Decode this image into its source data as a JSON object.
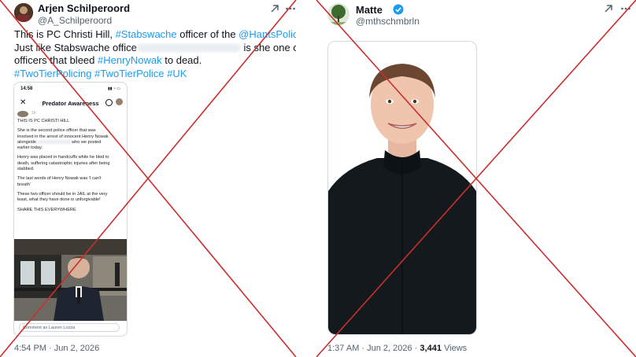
{
  "left_tweet": {
    "author_name": "Arjen Schilperoord",
    "author_handle": "@A_Schilperoord",
    "text": {
      "l1_a": "This is PC Christi Hill, ",
      "l1_tag": "#Stabswache",
      "l1_b": " officer of the ",
      "l1_mention": "@HantsPolice",
      "l1_c": ".",
      "l2_a": "Just like Stabswache office",
      "l2_b": " is she one of the",
      "l3_a": "officers that bleed ",
      "l3_tag": "#HenryNowak",
      "l3_b": " to dead.",
      "l4_tag1": "#TwoTierPolicing",
      "l4_tag2": "#TwoTierPolice",
      "l4_tag3": "#UK"
    },
    "embedded_screenshot": {
      "time": "14:58",
      "title": "Predator Awareness",
      "small_handle": "1h",
      "headline": "THIS IS PC CHRISTI HILL",
      "p1a": "She is the second police officer that was",
      "p1b": "involved in the arrest of innocent Henry Nowak",
      "p1c": "alongside",
      "p1d": "who we posted",
      "p1e": "earlier today.",
      "p2a": "Henry was placed in handcuffs while he bled to",
      "p2b": "death, suffering catastrophic injuries after being",
      "p2c": "stabbed.",
      "p3a": "The last words of Henry Nowak was 'I can't",
      "p3b": "breath'",
      "p4a": "These two officer should be in JAIL at the very",
      "p4b": "least, what they have done is unforgivable!",
      "p5": "SHARE THIS EVERYWHERE",
      "comment_placeholder": "Comment as Lauren Lozza"
    },
    "timestamp": "4:54 PM · Jun 2, 2026"
  },
  "right_tweet": {
    "author_name": "Matte",
    "author_handle": "@mthschmbrln",
    "verified": true,
    "timestamp_time": "1:37 AM · Jun 2, 2026 · ",
    "views_count": "3,441",
    "views_label": " Views"
  },
  "overlay": {
    "cross_color": "#c8302c",
    "icon_names": [
      "grok-icon",
      "more-icon",
      "verified-badge-icon",
      "close-icon",
      "search-icon"
    ]
  }
}
